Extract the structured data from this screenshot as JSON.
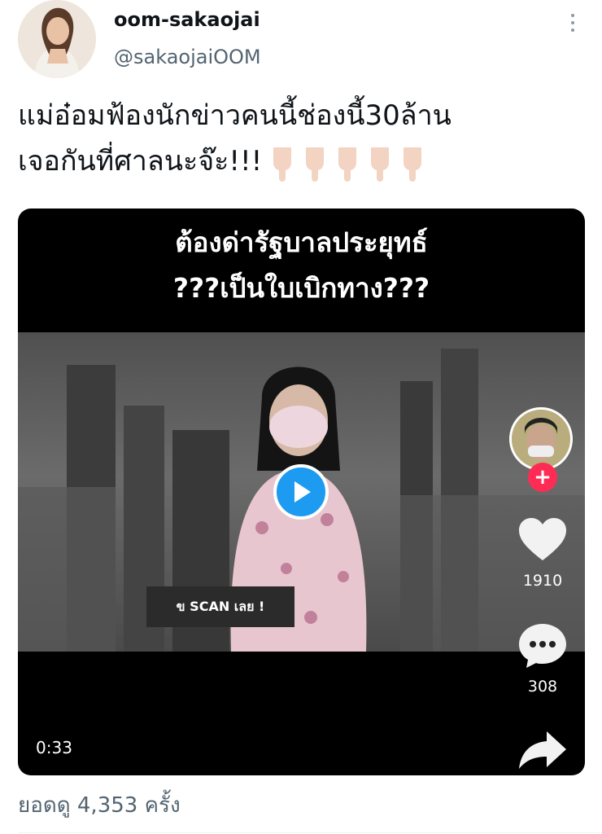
{
  "author": {
    "display_name": "oom-sakaojai",
    "handle": "@sakaojaiOOM"
  },
  "tweet": {
    "line1": "แม่อ๋อมฟ้องนักข่าวคนนี้ช่องนี้30ล้าน",
    "line2": "เจอกันที่ศาลนะจ๊ะ!!!",
    "emoji": [
      "👇🏻",
      "👇🏻",
      "👇🏻",
      "👇🏻",
      "👇🏻"
    ]
  },
  "video": {
    "caption_line1": "ต้องด่ารัฐบาลประยุทธ์",
    "caption_line2": "???เป็นใบเบิกทาง???",
    "lower_third": "ข SCAN เลย !",
    "duration": "0:33",
    "like_count": "1910",
    "comment_count": "308",
    "play_color": "#1d9bf0",
    "follow_color": "#fe2c55"
  },
  "views": "ยอดดู 4,353 ครั้ง"
}
